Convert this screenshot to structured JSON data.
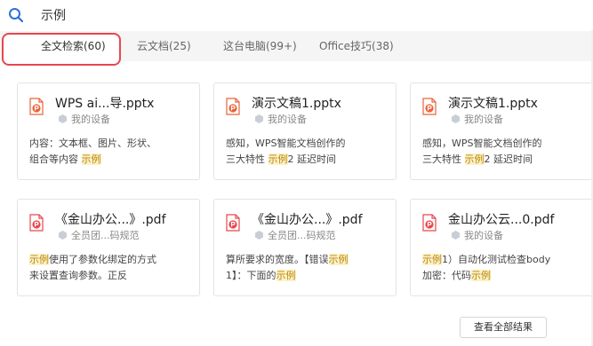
{
  "search": {
    "value": "示例",
    "icon": "search-icon"
  },
  "tabs": [
    {
      "label": "全文检索(60)",
      "active": true
    },
    {
      "label": "云文档(25)",
      "active": false
    },
    {
      "label": "这台电脑(99+)",
      "active": false
    },
    {
      "label": "Office技巧(38)",
      "active": false
    }
  ],
  "cards": [
    {
      "title": "WPS ai...导.pptx",
      "location": "我的设备",
      "file_type": "pptx",
      "snippet_lines": [
        [
          [
            "内容：文本框、图片、形状、",
            false
          ]
        ],
        [
          [
            "组合等内容 ",
            false
          ],
          [
            "示例",
            true
          ]
        ]
      ]
    },
    {
      "title": "演示文稿1.pptx",
      "location": "我的设备",
      "file_type": "pptx",
      "snippet_lines": [
        [
          [
            "感知，WPS智能文档创作的",
            false
          ]
        ],
        [
          [
            "三大特性 ",
            false
          ],
          [
            "示例",
            true
          ],
          [
            "2 延迟时间",
            false
          ]
        ]
      ]
    },
    {
      "title": "演示文稿1.pptx",
      "location": "我的设备",
      "file_type": "pptx",
      "snippet_lines": [
        [
          [
            "感知，WPS智能文档创作的",
            false
          ]
        ],
        [
          [
            "三大特性 ",
            false
          ],
          [
            "示例",
            true
          ],
          [
            "2 延迟时间",
            false
          ]
        ]
      ]
    },
    {
      "title": "《金山办公...》.pdf",
      "location": "全员团...码规范",
      "file_type": "pdf",
      "snippet_lines": [
        [
          [
            "示例",
            true
          ],
          [
            "使用了参数化绑定的方式",
            false
          ]
        ],
        [
          [
            "来设置查询参数。正反",
            false
          ]
        ]
      ]
    },
    {
      "title": "《金山办公...》.pdf",
      "location": "全员团...码规范",
      "file_type": "pdf",
      "snippet_lines": [
        [
          [
            "算所要求的宽度。【错误",
            false
          ],
          [
            "示例",
            true
          ]
        ],
        [
          [
            "1】：下面的",
            false
          ],
          [
            "示例",
            true
          ]
        ]
      ]
    },
    {
      "title": "金山办公云...0.pdf",
      "location": "我的设备",
      "file_type": "pdf",
      "snippet_lines": [
        [
          [
            "示例",
            true
          ],
          [
            "1）自动化测试检查body",
            false
          ]
        ],
        [
          [
            "加密：代码",
            false
          ],
          [
            "示例",
            true
          ]
        ]
      ]
    }
  ],
  "view_all_label": "查看全部结果",
  "colors": {
    "pptx": "#e8633a",
    "pdf": "#e8474e",
    "highlight_bg": "#fdf2c9",
    "highlight_text": "#b8860b",
    "accent": "#e8474e"
  }
}
